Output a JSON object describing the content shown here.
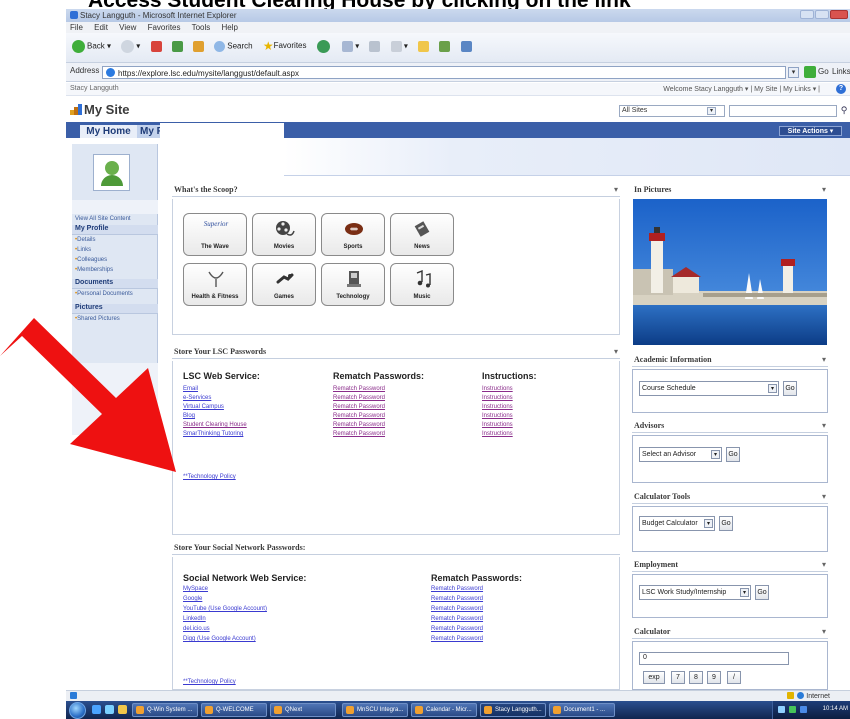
{
  "slide": {
    "title": "Access Student Clearing House by clicking on the link"
  },
  "browser": {
    "title": "Stacy Langguth - Microsoft Internet Explorer",
    "menu": [
      "File",
      "Edit",
      "View",
      "Favorites",
      "Tools",
      "Help"
    ],
    "toolbar": {
      "back": "Back",
      "search": "Search",
      "favorites": "Favorites"
    },
    "address_label": "Address",
    "url": "https://explore.lsc.edu/mysite/langgust/default.aspx",
    "go": "Go",
    "links": "Links"
  },
  "sharepoint": {
    "breadcrumb": "Stacy Langguth",
    "welcome": "Welcome Stacy Langguth ▾  |  My Site  |  My Links ▾  |",
    "site_title": "My Site",
    "scope": "All Sites",
    "tabs": {
      "home": "My Home",
      "profile": "My Profile"
    },
    "site_actions": "Site Actions ▾"
  },
  "quicklaunch": {
    "view_all": "View All Site Content",
    "profile": {
      "heading": "My Profile",
      "items": [
        "Details",
        "Links",
        "Colleagues",
        "Memberships"
      ]
    },
    "documents": {
      "heading": "Documents",
      "items": [
        "Personal Documents"
      ]
    },
    "pictures": {
      "heading": "Pictures",
      "items": [
        "Shared Pictures"
      ]
    }
  },
  "scoop": {
    "title": "What's the Scoop?",
    "tiles": [
      "The Wave",
      "Movies",
      "Sports",
      "News",
      "Health & Fitness",
      "Games",
      "Technology",
      "Music"
    ],
    "wave_logo": "Superior"
  },
  "lsc_passwords": {
    "title": "Store Your LSC Passwords",
    "headers": {
      "service": "LSC Web Service:",
      "rematch": "Rematch Passwords:",
      "instructions": "Instructions:"
    },
    "services": [
      "Email",
      "e-Services",
      "Virtual Campus",
      "Blog",
      "Student Clearing House",
      "SmarThinking Tutoring"
    ],
    "rematch_label": "Rematch Password",
    "instructions_label": "Instructions",
    "policy": "**Technology Policy"
  },
  "social_passwords": {
    "title": "Store Your Social Network Passwords:",
    "headers": {
      "service": "Social Network Web Service:",
      "rematch": "Rematch Passwords:"
    },
    "services": [
      "MySpace",
      "Google",
      "YouTube (Use Google Account)",
      "LinkedIn",
      "del.icio.us",
      "Digg (Use Google Account)"
    ],
    "rematch_label": "Rematch Password",
    "policy": "**Technology Policy"
  },
  "right_column": {
    "pictures": {
      "title": "In Pictures"
    },
    "academic": {
      "title": "Academic Information",
      "select": "Course Schedule",
      "go": "Go"
    },
    "advisors": {
      "title": "Advisors",
      "select": "Select an Advisor",
      "go": "Go"
    },
    "calculator_tools": {
      "title": "Calculator Tools",
      "select": "Budget Calculator",
      "go": "Go"
    },
    "employment": {
      "title": "Employment",
      "select": "LSC Work Study/Internship",
      "go": "Go"
    },
    "calculator": {
      "title": "Calculator",
      "display": "0",
      "keys": [
        "exp",
        "7",
        "8",
        "9",
        "/"
      ]
    }
  },
  "statusbar": {
    "zone": "Internet"
  },
  "taskbar": {
    "buttons": [
      "Q-Win System ...",
      "Q-WELCOME",
      "QNext",
      "MnSCU Integra...",
      "Calendar - Micr...",
      "Stacy Langguth...",
      "Document1 - ..."
    ],
    "clock": "10:14 AM"
  },
  "colors": {
    "nav": "#3b5fa8",
    "link": "#3a3ad0",
    "visited": "#8a2c8a",
    "arrow": "#ee1111"
  }
}
